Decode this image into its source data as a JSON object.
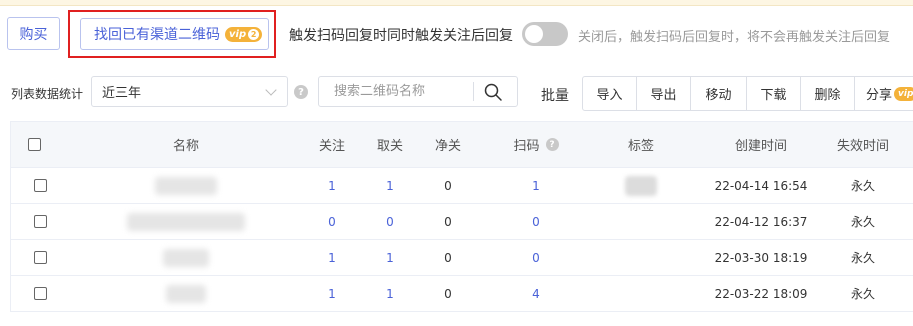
{
  "top_actions": {
    "buy_label": "购买",
    "find_label": "找回已有渠道二维码",
    "find_vip": "vip",
    "find_vip_level": "2"
  },
  "toggle": {
    "label": "触发扫码回复时同时触发关注后回复",
    "on": false,
    "hint": "关闭后，触发扫码后回复时，将不会再触发关注后回复"
  },
  "filters": {
    "stat_label": "列表数据统计",
    "range_value": "近三年",
    "search_placeholder": "搜索二维码名称"
  },
  "batch": {
    "label": "批量",
    "buttons": [
      "导入",
      "导出",
      "移动",
      "下载",
      "删除",
      "分享"
    ],
    "share_vip": "vip"
  },
  "table": {
    "headers": {
      "name": "名称",
      "follow": "关注",
      "unfollow": "取关",
      "net": "净关",
      "scan": "扫码",
      "tag": "标签",
      "created": "创建时间",
      "expire": "失效时间"
    },
    "rows": [
      {
        "follow": "1",
        "unfollow": "1",
        "net": "0",
        "scan": "1",
        "created": "22-04-14 16:54",
        "expire": "永久"
      },
      {
        "follow": "0",
        "unfollow": "0",
        "net": "0",
        "scan": "0",
        "created": "22-04-12 16:37",
        "expire": "永久"
      },
      {
        "follow": "1",
        "unfollow": "1",
        "net": "0",
        "scan": "0",
        "created": "22-03-30 18:19",
        "expire": "永久"
      },
      {
        "follow": "1",
        "unfollow": "1",
        "net": "0",
        "scan": "4",
        "created": "22-03-22 18:09",
        "expire": "永久"
      }
    ]
  },
  "colors": {
    "accent": "#4a62d8",
    "vip": "#f4b23a",
    "highlight": "#e02020"
  }
}
